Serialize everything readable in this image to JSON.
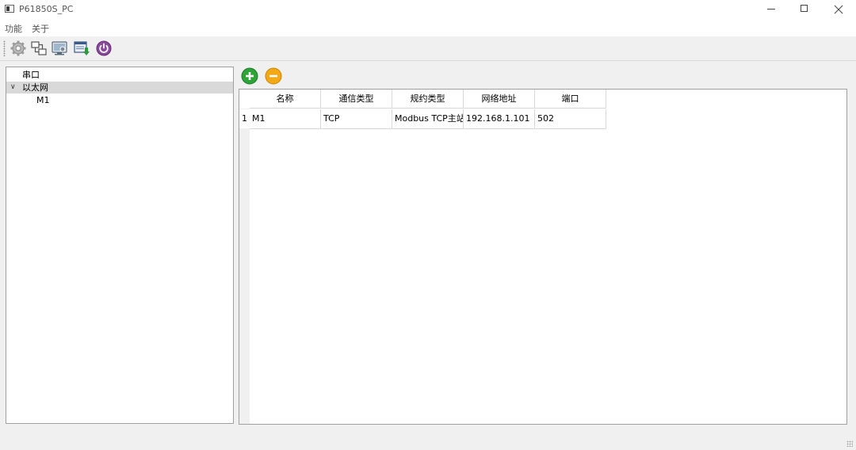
{
  "window": {
    "title": "P61850S_PC",
    "minimize_label": "—",
    "maximize_label": "☐",
    "close_label": "✕"
  },
  "menu": {
    "items": [
      {
        "label": "功能"
      },
      {
        "label": "关于"
      }
    ]
  },
  "toolbar": {
    "buttons": [
      {
        "icon": "gear-icon"
      },
      {
        "icon": "network-icon"
      },
      {
        "icon": "monitor-icon"
      },
      {
        "icon": "download-window-icon"
      },
      {
        "icon": "power-icon"
      }
    ]
  },
  "tree": {
    "items": [
      {
        "label": "串口",
        "level": 0,
        "expanded": null,
        "selected": false
      },
      {
        "label": "以太网",
        "level": 0,
        "expanded": true,
        "selected": true
      },
      {
        "label": "M1",
        "level": 1,
        "expanded": null,
        "selected": false
      }
    ],
    "expand_arrow": "∨"
  },
  "actions": {
    "add_icon": "plus-circle-icon",
    "remove_icon": "minus-circle-icon",
    "add_color": "#2fa33a",
    "remove_color": "#f2a914"
  },
  "table": {
    "columns": [
      "名称",
      "通信类型",
      "规约类型",
      "网络地址",
      "端口"
    ],
    "rows": [
      {
        "index": "1",
        "cells": [
          "M1",
          "TCP",
          "Modbus TCP主站",
          "192.168.1.101",
          "502"
        ]
      }
    ]
  }
}
